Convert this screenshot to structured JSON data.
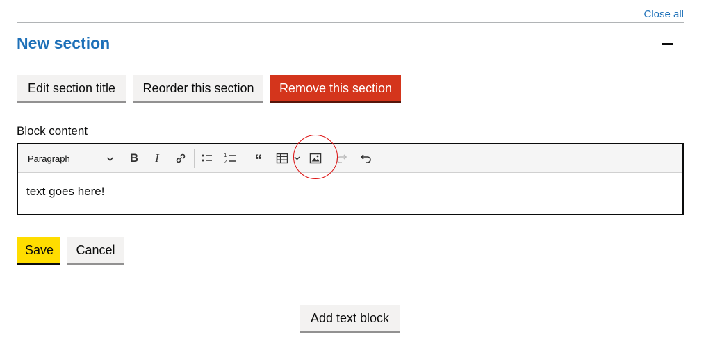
{
  "header": {
    "close_all": "Close all"
  },
  "section": {
    "title": "New section",
    "buttons": {
      "edit_title": "Edit section title",
      "reorder": "Reorder this section",
      "remove": "Remove this section"
    }
  },
  "editor": {
    "label": "Block content",
    "toolbar": {
      "paragraph_select": "Paragraph",
      "icons": [
        "chevron-down-icon",
        "bold-icon",
        "italic-icon",
        "link-icon",
        "bulleted-list-icon",
        "numbered-list-icon",
        "blockquote-icon",
        "table-icon",
        "image-icon",
        "redo-icon",
        "undo-icon"
      ]
    },
    "content": "text goes here!"
  },
  "actions": {
    "save": "Save",
    "cancel": "Cancel",
    "add_text_block": "Add text block"
  },
  "colors": {
    "link": "#1d70b8",
    "danger": "#d4351c",
    "primary_yellow": "#ffdd00",
    "annotation_red": "#dd1111"
  }
}
